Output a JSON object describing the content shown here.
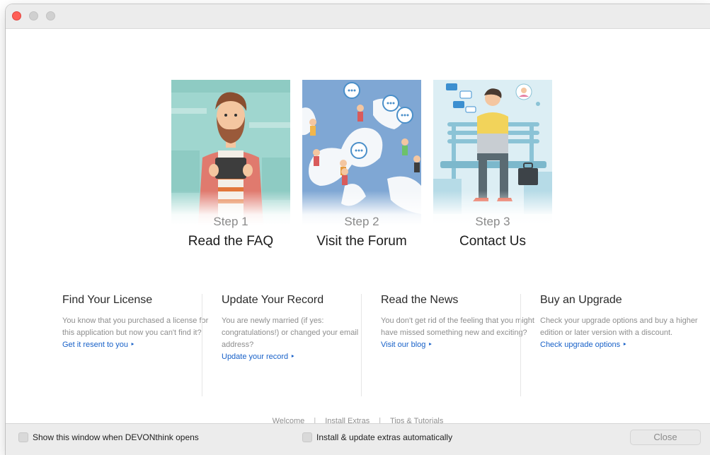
{
  "steps": [
    {
      "number": "Step 1",
      "title": "Read the FAQ"
    },
    {
      "number": "Step 2",
      "title": "Visit the Forum"
    },
    {
      "number": "Step 3",
      "title": "Contact Us"
    }
  ],
  "columns": [
    {
      "heading": "Find Your License",
      "body": "You know that you purchased a license for this application but now you can't find it?",
      "link": "Get it resent to you ‣"
    },
    {
      "heading": "Update Your Record",
      "body": "You are newly married (if yes: congratulations!) or changed your email address?",
      "link": "Update your record ‣"
    },
    {
      "heading": "Read the News",
      "body": "You don't get rid of the feeling that you might have missed something new and exciting?",
      "link": "Visit our blog ‣"
    },
    {
      "heading": "Buy an Upgrade",
      "body": "Check your upgrade options and buy a higher edition or later version with a discount.",
      "link": "Check upgrade options ‣"
    }
  ],
  "footer_links": {
    "welcome": "Welcome",
    "install_extras": "Install Extras",
    "tips": "Tips & Tutorials",
    "separator": "|"
  },
  "bottom_bar": {
    "show_window_label": "Show this window when DEVONthink opens",
    "extras_label": "Install & update extras automatically",
    "close_label": "Close"
  },
  "colors": {
    "link": "#1861c8",
    "close_light": "#ff5f57"
  }
}
